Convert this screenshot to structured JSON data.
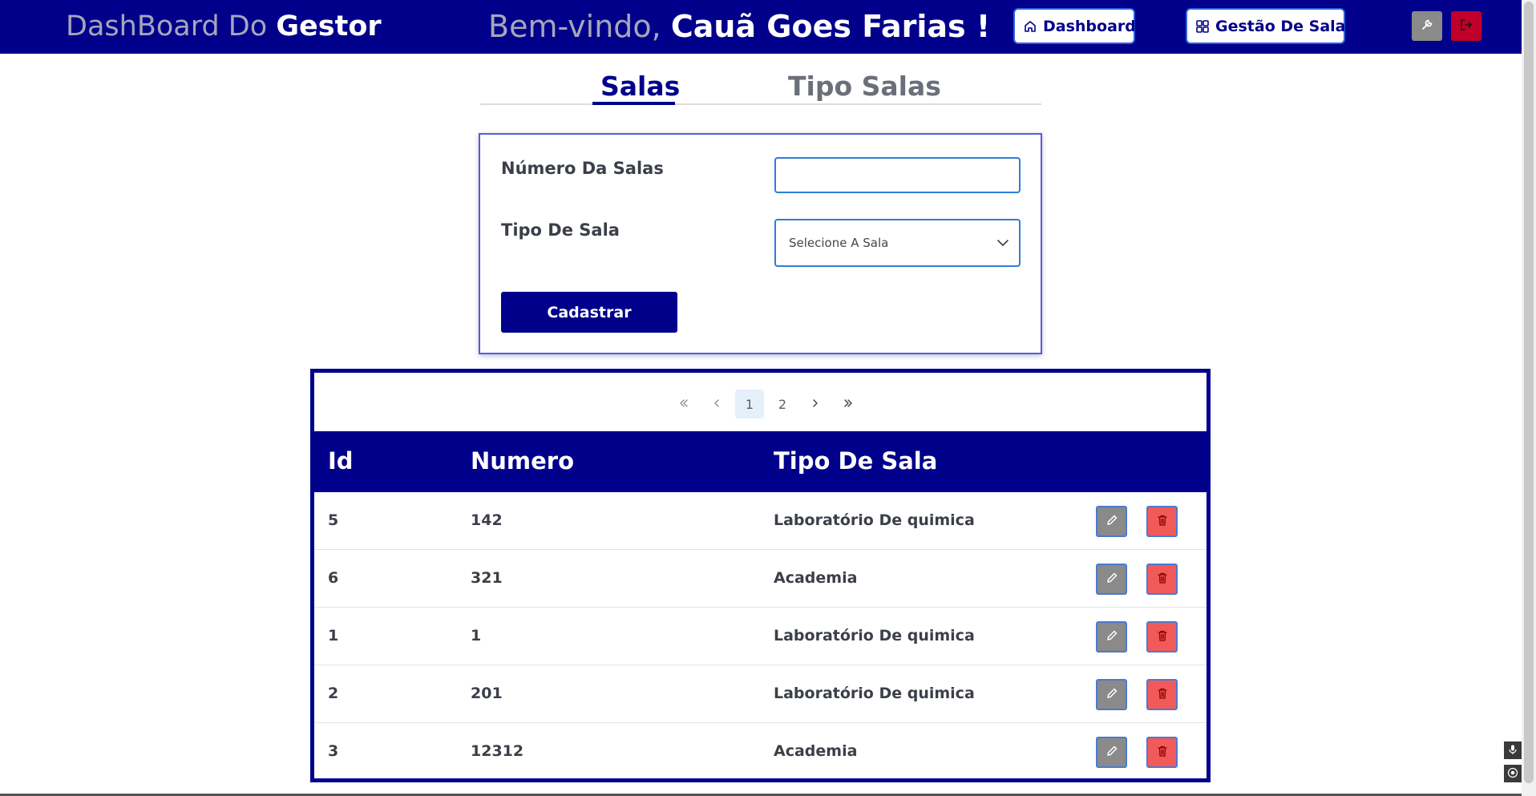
{
  "header": {
    "brand_light": "DashBoard Do",
    "brand_strong": "Gestor",
    "welcome_light": "Bem-vindo,",
    "welcome_strong": "Cauã Goes Farias !",
    "nav": {
      "dashboard_label": "Dashboard",
      "gestao_label": "Gestão De Salas"
    },
    "colors": {
      "bar": "#00008b",
      "logout": "#c0002a",
      "settings": "#8a8a8a"
    }
  },
  "tabs": [
    {
      "label": "Salas",
      "active": true
    },
    {
      "label": "Tipo Salas",
      "active": false
    }
  ],
  "form": {
    "numero_label": "Número Da Salas",
    "numero_value": "",
    "tipo_label": "Tipo De Sala",
    "tipo_selected": "Selecione A Sala",
    "submit_label": "Cadastrar"
  },
  "pagination": {
    "first": "«",
    "prev": "‹",
    "pages": [
      "1",
      "2"
    ],
    "current": "1",
    "next": "›",
    "last": "»"
  },
  "table": {
    "headers": {
      "id": "Id",
      "numero": "Numero",
      "tipo": "Tipo De Sala"
    },
    "rows": [
      {
        "id": "5",
        "numero": "142",
        "tipo": "Laboratório De quimica"
      },
      {
        "id": "6",
        "numero": "321",
        "tipo": "Academia"
      },
      {
        "id": "1",
        "numero": "1",
        "tipo": "Laboratório De quimica"
      },
      {
        "id": "2",
        "numero": "201",
        "tipo": "Laboratório De quimica"
      },
      {
        "id": "3",
        "numero": "12312",
        "tipo": "Academia"
      }
    ],
    "row_actions": [
      "pencil-icon",
      "trash-icon"
    ]
  }
}
